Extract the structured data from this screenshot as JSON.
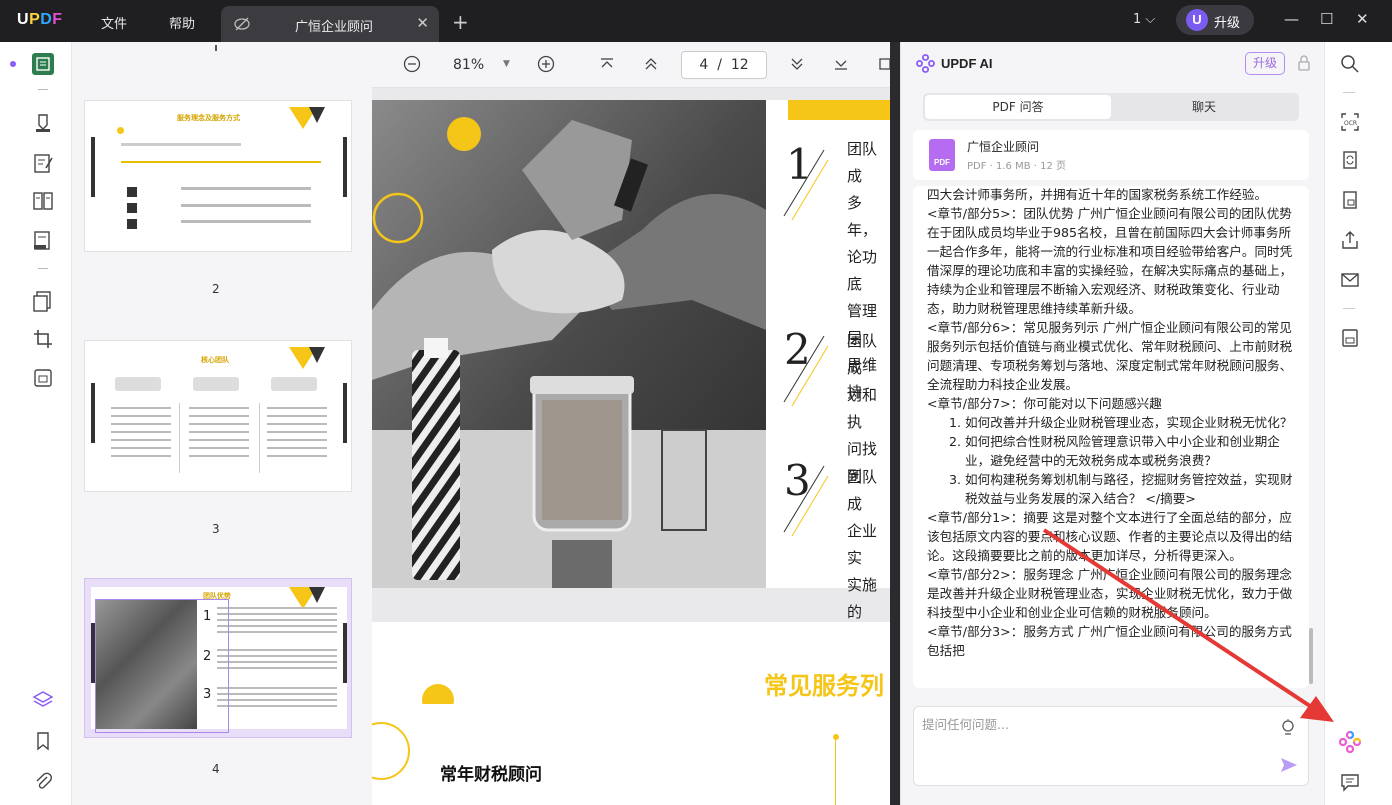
{
  "titlebar": {
    "menu": [
      "文件",
      "帮助"
    ],
    "tab_title": "广恒企业顾问",
    "page_indicator": "1",
    "upgrade_label": "升级",
    "avatar_letter": "U"
  },
  "toolbar": {
    "zoom": "81%",
    "page_current": "4",
    "page_sep": "/",
    "page_total": "12"
  },
  "thumbnails": [
    {
      "label": "2",
      "heading": "服务理念及服务方式"
    },
    {
      "label": "3",
      "heading": "核心团队"
    },
    {
      "label": "4",
      "heading": "团队优势"
    }
  ],
  "page_content": {
    "numbers": [
      "1",
      "2",
      "3"
    ],
    "texts": [
      [
        "团队成",
        "多年，",
        "论功底",
        "管理层",
        "思维持"
      ],
      [
        "团队成",
        "划和执",
        "问找到"
      ],
      [
        "团队成",
        "企业实",
        "实施的"
      ]
    ],
    "next_title": "常见服务列",
    "next_subtitle": "常年财税顾问"
  },
  "ai_panel": {
    "title": "UPDF AI",
    "upgrade": "升级",
    "tabs": [
      "PDF 问答",
      "聊天"
    ],
    "file": {
      "name": "广恒企业顾问",
      "meta": "PDF · 1.6 MB · 12 页",
      "badge": "PDF"
    },
    "messages": {
      "p1": "四大会计师事务所，并拥有近十年的国家税务系统工作经验。",
      "p2": "<章节/部分5>：团队优势 广州广恒企业顾问有限公司的团队优势在于团队成员均毕业于985名校，且曾在前国际四大会计师事务所一起合作多年，能将一流的行业标准和项目经验带给客户。同时凭借深厚的理论功底和丰富的实操经验，在解决实际痛点的基础上，持续为企业和管理层不断输入宏观经济、财税政策变化、行业动态，助力财税管理思维持续革新升级。",
      "p3": "<章节/部分6>：常见服务列示 广州广恒企业顾问有限公司的常见服务列示包括价值链与商业模式优化、常年财税顾问、上市前财税问题清理、专项税务筹划与落地、深度定制式常年财税顾问服务、全流程助力科技企业发展。",
      "p4": "<章节/部分7>：你可能对以下问题感兴趣",
      "list": [
        "如何改善并升级企业财税管理业态，实现企业财税无忧化？",
        "如何把综合性财税风险管理意识带入中小企业和创业期企业，避免经营中的无效税务成本或税务浪费？",
        "如何构建税务筹划机制与路径，挖掘财务管控效益，实现财税效益与业务发展的深入结合？ </摘要>"
      ],
      "p5": "<章节/部分1>：摘要 这是对整个文本进行了全面总结的部分，应该包括原文内容的要点和核心议题、作者的主要论点以及得出的结论。这段摘要要比之前的版本更加详尽，分析得更深入。",
      "p6": "<章节/部分2>：服务理念 广州广恒企业顾问有限公司的服务理念是改善并升级企业财税管理业态，实现企业财税无忧化，致力于做科技型中小企业和创业企业可信赖的财税服务顾问。",
      "p7": "<章节/部分3>：服务方式 广州广恒企业顾问有限公司的服务方式包括把"
    },
    "input_placeholder": "提问任何问题..."
  },
  "colors": {
    "accent": "#f5c518",
    "ai_purple": "#8b5cf6",
    "arrow": "#e53935"
  }
}
